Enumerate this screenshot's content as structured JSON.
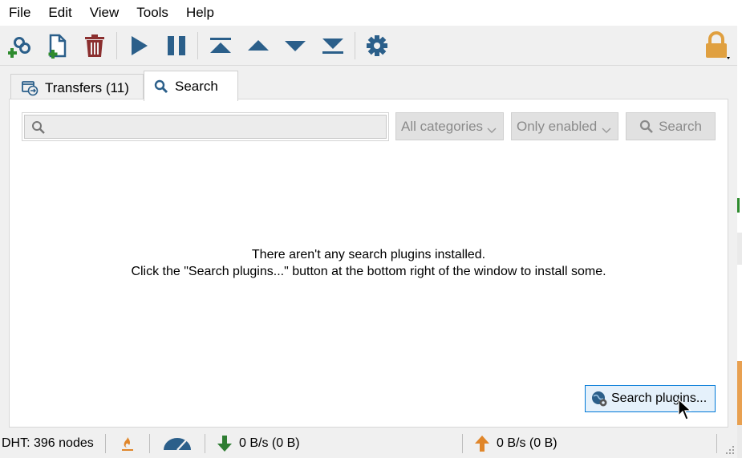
{
  "menu": [
    "File",
    "Edit",
    "View",
    "Tools",
    "Help"
  ],
  "toolbar": {
    "icons": [
      "add-torrent-link-icon",
      "add-torrent-file-icon",
      "delete-icon",
      "resume-icon",
      "pause-icon",
      "move-top-icon",
      "move-up-icon",
      "move-down-icon",
      "move-bottom-icon",
      "options-gear-icon",
      "lock-icon"
    ]
  },
  "tabs": {
    "transfers": "Transfers (11)",
    "search": "Search"
  },
  "search": {
    "query_value": "",
    "category": "All categories",
    "plugins_filter": "Only enabled",
    "button": "Search"
  },
  "message": {
    "line1": "There aren't any search plugins installed.",
    "line2": "Click the \"Search plugins...\" button at the bottom right of the window to install some."
  },
  "plugins_button": "Search plugins...",
  "status": {
    "dht": "DHT: 396 nodes",
    "download": "0 B/s (0 B)",
    "upload": "0 B/s (0 B)"
  },
  "colors": {
    "accent_blue": "#0078d7",
    "toolbar_icon": "#2b5f8a",
    "delete_red": "#8b2f2f",
    "green": "#2e8b2e",
    "lock_orange": "#e0a040"
  }
}
